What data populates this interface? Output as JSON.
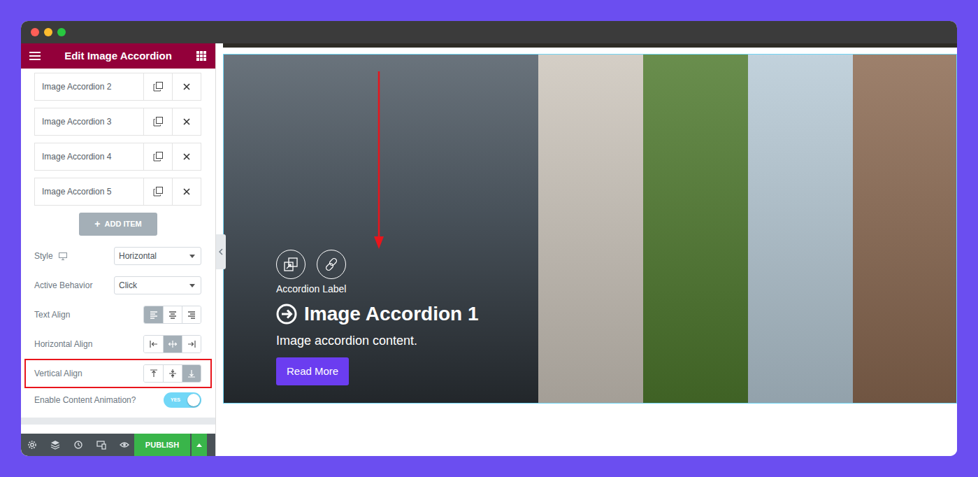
{
  "panel": {
    "title": "Edit Image Accordion"
  },
  "items": [
    {
      "label": "Image Accordion 2"
    },
    {
      "label": "Image Accordion 3"
    },
    {
      "label": "Image Accordion 4"
    },
    {
      "label": "Image Accordion 5"
    }
  ],
  "add_button": {
    "icon": "+",
    "label": "ADD ITEM"
  },
  "controls": [
    {
      "kind": "select",
      "label": "Style",
      "value": "Horizontal",
      "responsive": true,
      "highlighted": false
    },
    {
      "kind": "select",
      "label": "Active Behavior",
      "value": "Click",
      "highlighted": false
    },
    {
      "kind": "choices",
      "label": "Text Align",
      "options": [
        {
          "selected": true
        },
        {
          "selected": false
        },
        {
          "selected": false
        }
      ],
      "highlighted": false
    },
    {
      "kind": "choices",
      "label": "Horizontal Align",
      "options": [
        {
          "selected": false
        },
        {
          "selected": true
        },
        {
          "selected": false
        }
      ],
      "highlighted": false
    },
    {
      "kind": "choices",
      "label": "Vertical Align",
      "options": [
        {
          "selected": false
        },
        {
          "selected": false
        },
        {
          "selected": true
        }
      ],
      "highlighted": true
    },
    {
      "kind": "toggle",
      "label": "Enable Content Animation?",
      "on": true,
      "text": "YES",
      "highlighted": false
    }
  ],
  "footer": {
    "publish": "PUBLISH"
  },
  "accordion": {
    "arrow_shown": true,
    "panels": [
      {
        "active": true,
        "color": "#55606a",
        "label": "Accordion Label",
        "title": "Image Accordion 1",
        "content": "Image accordion content.",
        "button": "Read More"
      },
      {
        "active": false,
        "color": "#cdc6bc"
      },
      {
        "active": false,
        "color": "#4f7a2e"
      },
      {
        "active": false,
        "color": "#b7cad6"
      },
      {
        "active": false,
        "color": "#8c6a52"
      }
    ]
  }
}
